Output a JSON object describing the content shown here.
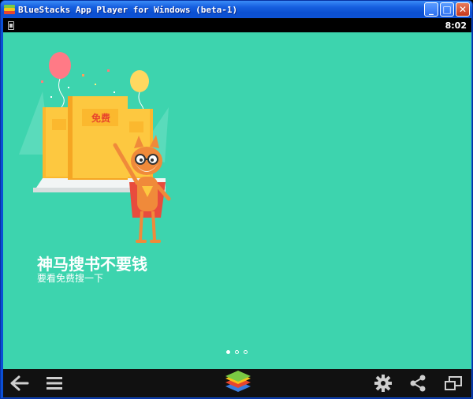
{
  "window": {
    "title": "BlueStacks App Player for Windows (beta-1)",
    "minimize_label": "_",
    "maximize_label": "□",
    "close_label": "✕"
  },
  "status_bar": {
    "time": "8:02"
  },
  "onboarding": {
    "badge": "免费",
    "headline": "神马搜书不要钱",
    "subline": "要看免费搜一下",
    "page_count": 3,
    "active_page": 1
  },
  "colors": {
    "background": "#3dd4ae",
    "book": "#fdc840",
    "titlebar": "#0b4fd0"
  },
  "nav_icons": [
    "back-arrow-icon",
    "menu-icon",
    "bluestacks-logo-icon",
    "settings-gear-icon",
    "share-icon",
    "window-resize-icon"
  ]
}
